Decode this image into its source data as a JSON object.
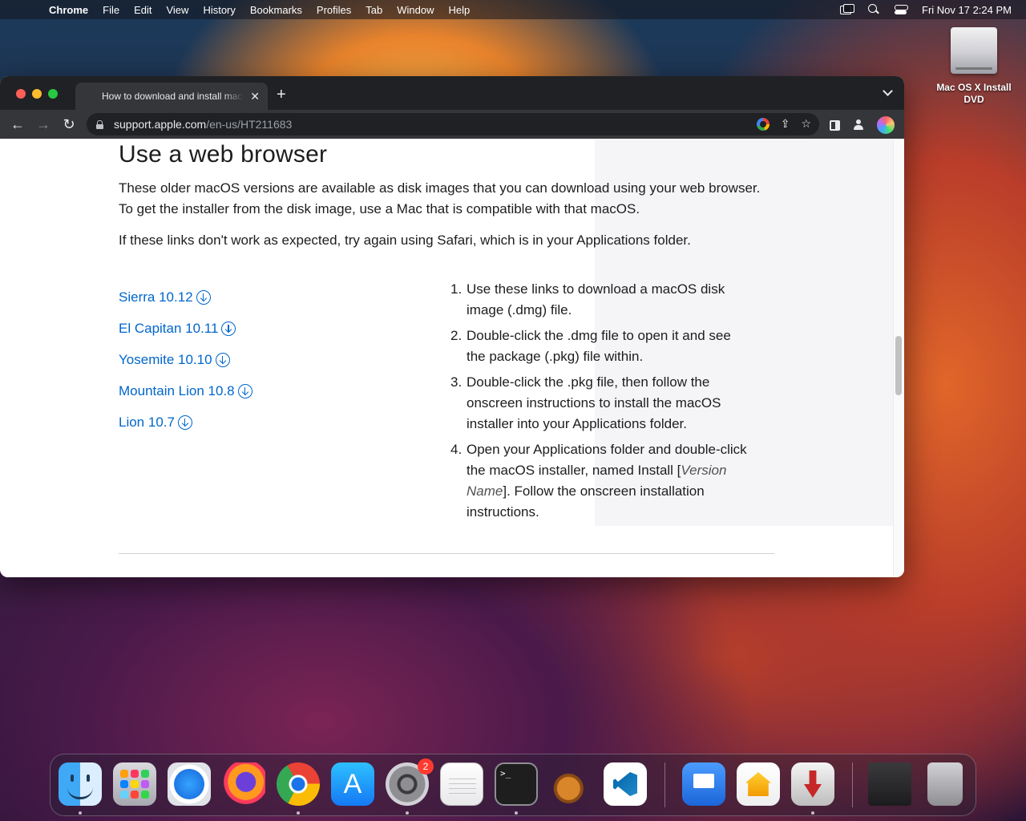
{
  "menubar": {
    "app_name": "Chrome",
    "menus": [
      "File",
      "Edit",
      "View",
      "History",
      "Bookmarks",
      "Profiles",
      "Tab",
      "Window",
      "Help"
    ],
    "clock": "Fri Nov 17  2:24 PM"
  },
  "desktop": {
    "icon_label_line1": "Mac OS X Install",
    "icon_label_line2": "DVD"
  },
  "browser": {
    "tab_title": "How to download and install macOS",
    "new_tab_symbol": "+",
    "url_host": "support.apple.com",
    "url_path": "/en-us/HT211683"
  },
  "page": {
    "heading": "Use a web browser",
    "para1_line1": "These older macOS versions are available as disk images that you can download using your web browser.",
    "para1_line2": "To get the installer from the disk image, use a Mac that is compatible with that macOS.",
    "para2": "If these links don't work as expected, try again using Safari, which is in your Applications folder.",
    "download_links": [
      "Sierra 10.12",
      "El Capitan 10.11",
      "Yosemite 10.10",
      "Mountain Lion 10.8",
      "Lion 10.7"
    ],
    "steps": [
      {
        "num": "1.",
        "text": "Use these links to download a macOS disk image (.dmg) file."
      },
      {
        "num": "2.",
        "text": "Double-click the .dmg file to open it and see the package (.pkg) file within."
      },
      {
        "num": "3.",
        "text": "Double-click the .pkg file, then follow the onscreen instructions to install the macOS installer into your Applications folder."
      }
    ],
    "step4": {
      "num": "4.",
      "before": "Open your Applications folder and double-click the macOS installer, named Install [",
      "italic": "Version Name",
      "after": "]. Follow the onscreen installation instructions."
    }
  },
  "dock": {
    "apps": [
      "Finder",
      "Launchpad",
      "Safari",
      "Firefox",
      "Google Chrome",
      "App Store",
      "System Preferences",
      "TextEdit",
      "Terminal",
      "GarageBand",
      "Visual Studio Code",
      "Keynote",
      "Home",
      "Downie",
      "Downloads",
      "Trash"
    ],
    "system_preferences_badge": "2",
    "terminal_prompt": ">_"
  },
  "colors": {
    "link": "#0066cc",
    "text": "#1d1d1f",
    "chrome_dark": "#35363a",
    "badge": "#ff3b30"
  }
}
